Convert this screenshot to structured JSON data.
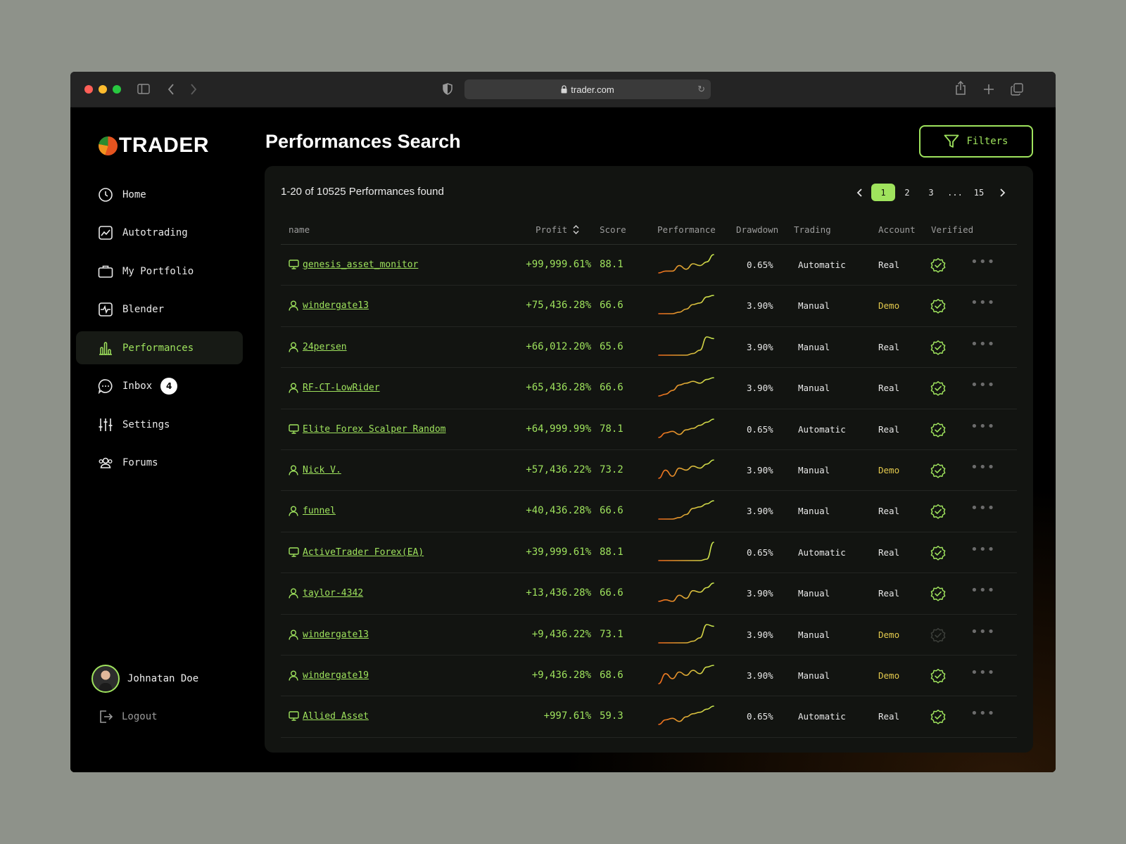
{
  "browser": {
    "url": "trader.com",
    "traffic_lights": [
      "#fe5f57",
      "#febc2e",
      "#28c840"
    ]
  },
  "brand": {
    "name": "TRADER"
  },
  "sidebar": {
    "items": [
      {
        "label": "Home"
      },
      {
        "label": "Autotrading"
      },
      {
        "label": "My Portfolio"
      },
      {
        "label": "Blender"
      },
      {
        "label": "Performances"
      },
      {
        "label": "Inbox",
        "badge": "4"
      },
      {
        "label": "Settings"
      },
      {
        "label": "Forums"
      }
    ],
    "active": "Performances"
  },
  "user": {
    "name": "Johnatan Doe",
    "logout_label": "Logout"
  },
  "page": {
    "title": "Performances Search",
    "filters_label": "Filters"
  },
  "results": {
    "summary": "1-20 of 10525 Performances found",
    "pages": [
      "1",
      "2",
      "3",
      "...",
      "15"
    ],
    "current_page": "1"
  },
  "table": {
    "columns": {
      "name": "name",
      "profit": "Profit",
      "score": "Score",
      "performance": "Performance",
      "drawdown": "Drawdown",
      "trading": "Trading",
      "account": "Account",
      "verified": "Verified"
    },
    "rows": [
      {
        "type": "bot",
        "name": "genesis_asset_monitor",
        "profit": "+99,999.61%",
        "score": "88.1",
        "drawdown": "0.65%",
        "trading": "Automatic",
        "account": "Real",
        "verified": true,
        "spark": [
          2,
          3,
          3,
          6,
          4,
          7,
          6,
          8,
          12
        ]
      },
      {
        "type": "user",
        "name": "windergate13",
        "profit": "+75,436.28%",
        "score": "66.6",
        "drawdown": "3.90%",
        "trading": "Manual",
        "account": "Demo",
        "verified": true,
        "spark": [
          1,
          1,
          1,
          2,
          4,
          7,
          8,
          12,
          13
        ]
      },
      {
        "type": "user",
        "name": "24persen",
        "profit": "+66,012.20%",
        "score": "65.6",
        "drawdown": "3.90%",
        "trading": "Manual",
        "account": "Real",
        "verified": true,
        "spark": [
          1,
          1,
          1,
          1,
          1,
          2,
          4,
          12,
          11
        ]
      },
      {
        "type": "user",
        "name": "RF-CT-LowRider",
        "profit": "+65,436.28%",
        "score": "66.6",
        "drawdown": "3.90%",
        "trading": "Manual",
        "account": "Real",
        "verified": true,
        "spark": [
          2,
          3,
          5,
          8,
          9,
          10,
          9,
          11,
          12
        ]
      },
      {
        "type": "bot",
        "name": "Elite Forex Scalper Random",
        "profit": "+64,999.99%",
        "score": "78.1",
        "drawdown": "0.65%",
        "trading": "Automatic",
        "account": "Real",
        "verified": true,
        "spark": [
          1,
          4,
          5,
          3,
          6,
          7,
          9,
          11,
          13
        ]
      },
      {
        "type": "user",
        "name": "Nick V.",
        "profit": "+57,436.22%",
        "score": "73.2",
        "drawdown": "3.90%",
        "trading": "Manual",
        "account": "Demo",
        "verified": true,
        "spark": [
          2,
          6,
          3,
          7,
          6,
          8,
          7,
          9,
          11
        ]
      },
      {
        "type": "user",
        "name": "funnel",
        "profit": "+40,436.28%",
        "score": "66.6",
        "drawdown": "3.90%",
        "trading": "Manual",
        "account": "Real",
        "verified": true,
        "spark": [
          1,
          1,
          1,
          2,
          4,
          8,
          9,
          11,
          13
        ]
      },
      {
        "type": "bot",
        "name": "ActiveTrader Forex(EA)",
        "profit": "+39,999.61%",
        "score": "88.1",
        "drawdown": "0.65%",
        "trading": "Automatic",
        "account": "Real",
        "verified": true,
        "spark": [
          1,
          1,
          1,
          1,
          1,
          1,
          1,
          2,
          14
        ]
      },
      {
        "type": "user",
        "name": "taylor-4342",
        "profit": "+13,436.28%",
        "score": "66.6",
        "drawdown": "3.90%",
        "trading": "Manual",
        "account": "Real",
        "verified": true,
        "spark": [
          1,
          2,
          1,
          5,
          3,
          8,
          7,
          10,
          13
        ]
      },
      {
        "type": "user",
        "name": "windergate13",
        "profit": "+9,436.22%",
        "score": "73.1",
        "drawdown": "3.90%",
        "trading": "Manual",
        "account": "Demo",
        "verified": false,
        "spark": [
          1,
          1,
          1,
          1,
          1,
          2,
          4,
          12,
          11
        ]
      },
      {
        "type": "user",
        "name": "windergate19",
        "profit": "+9,436.28%",
        "score": "68.6",
        "drawdown": "3.90%",
        "trading": "Manual",
        "account": "Demo",
        "verified": true,
        "spark": [
          1,
          7,
          4,
          8,
          6,
          9,
          7,
          11,
          12
        ]
      },
      {
        "type": "bot",
        "name": "Allied Asset",
        "profit": "+997.61%",
        "score": "59.3",
        "drawdown": "0.65%",
        "trading": "Automatic",
        "account": "Real",
        "verified": true,
        "spark": [
          1,
          4,
          5,
          3,
          6,
          8,
          9,
          11,
          13
        ]
      }
    ]
  },
  "colors": {
    "accent": "#9fe35d",
    "demo": "#e3c94d",
    "spark_start": "#f06a1b",
    "spark_end": "#c9ea4f",
    "panel": "#121411"
  },
  "icons": {
    "nav": [
      "clock-icon",
      "chart-line-icon",
      "briefcase-icon",
      "pulse-icon",
      "bar-chart-icon",
      "chat-bubble-icon",
      "sliders-icon",
      "users-icon"
    ],
    "row_bot": "monitor-icon",
    "row_user": "user-icon",
    "verified": "verified-badge-icon",
    "more": "more-dots-icon",
    "filter": "funnel-icon"
  }
}
